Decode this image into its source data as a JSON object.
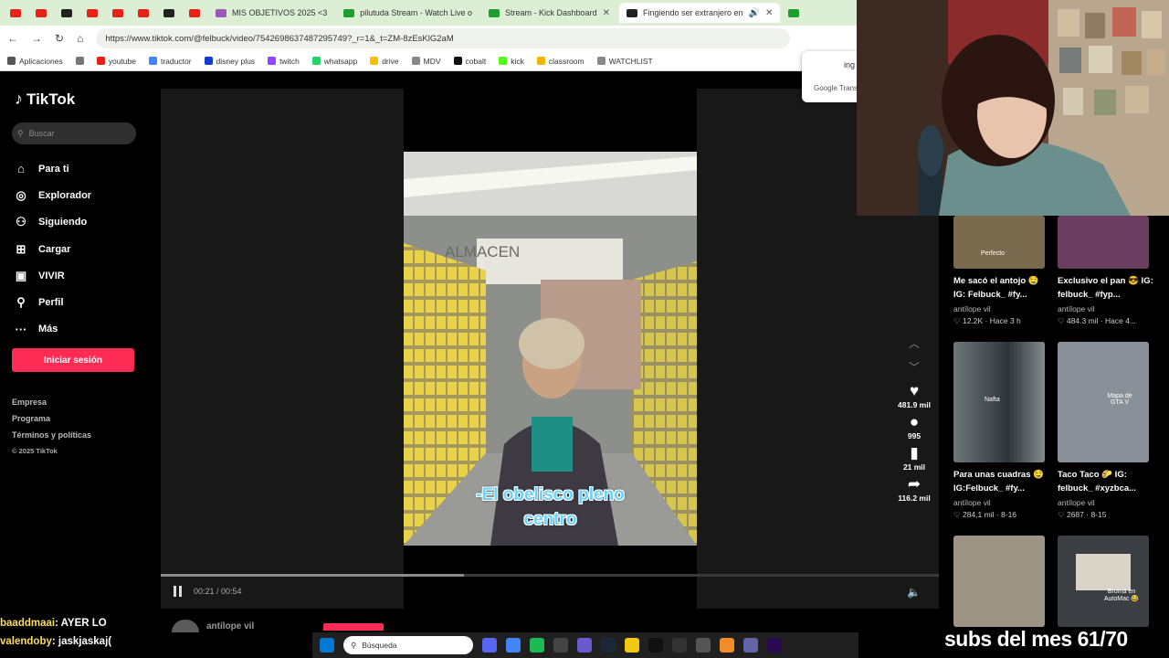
{
  "browser": {
    "tabs": [
      {
        "label": "MIS OBJETIVOS 2025 <3",
        "icon": "purple-icon"
      },
      {
        "label": "pilutuda Stream - Watch Live o",
        "icon": "kick-icon"
      },
      {
        "label": "Stream - Kick Dashboard",
        "icon": "kick-icon"
      },
      {
        "label": "Fingiendo ser extranjero en",
        "icon": "tiktok-icon",
        "active": true
      }
    ],
    "tab_close": "✕",
    "url": "https://www.tiktok.com/@felbuck/video/7542698637487295749?_r=1&_t=ZM-8zEsKlG2aM",
    "bookmarks": [
      "Aplicaciones",
      "youtube",
      "traductor",
      "disney plus",
      "twitch",
      "whatsapp",
      "drive",
      "MDV",
      "cobalt",
      "kick",
      "classroom",
      "WATCHLIST"
    ],
    "translate_popup": {
      "text1": "ing",
      "text2": "Google Trans"
    }
  },
  "tiktok": {
    "logo": "TikTok",
    "search_placeholder": "Buscar",
    "nav": [
      {
        "label": "Para ti",
        "icon": "home-icon"
      },
      {
        "label": "Explorador",
        "icon": "compass-icon"
      },
      {
        "label": "Siguiendo",
        "icon": "following-icon"
      },
      {
        "label": "Cargar",
        "icon": "upload-icon"
      },
      {
        "label": "VIVIR",
        "icon": "live-icon"
      },
      {
        "label": "Perfil",
        "icon": "profile-icon"
      },
      {
        "label": "Más",
        "icon": "more-icon"
      }
    ],
    "login": "Iniciar sesión",
    "footer": [
      "Empresa",
      "Programa",
      "Términos y políticas",
      "© 2025 TikTok"
    ],
    "video": {
      "subtitle_line1": "-El obelisco pleno",
      "subtitle_line2": "centro",
      "time": "00:21 / 00:54",
      "progress": 0.39
    },
    "actions": {
      "likes": "481.9 mil",
      "comments": "995",
      "saves": "21 mil",
      "shares": "116.2 mil"
    },
    "related": [
      {
        "title": "Me sacó el antojo 🤤 IG: Felbuck_ #fy...",
        "author": "antílope vil",
        "stats": "♡ 12.2K · Hace 3 h"
      },
      {
        "title": "Exclusivo el pan 😎 IG: felbuck_ #fyp...",
        "author": "antílope vil",
        "stats": "♡ 484.3 mil · Hace 4..."
      },
      {
        "title": "Para unas cuadras 🤤 IG:Felbuck_ #fy...",
        "author": "antílope vil",
        "stats": "♡ 284,1 mil · 8-16"
      },
      {
        "title": "Taco Taco 🌮 IG: felbuck_ #xyzbca...",
        "author": "antílope vil",
        "stats": "♡ 2687 · 8-15"
      }
    ],
    "thumb_texts": [
      "Perfecto",
      "Nafta",
      "Mapa de GTA V",
      "Broma en AutoMac 😂"
    ],
    "overlay_name": "antílope vil"
  },
  "stream": {
    "chat": [
      {
        "user": "baaddmaai",
        "message": ": AYER LO"
      },
      {
        "user": "valendoby",
        "message": ": jaskjaskaj("
      }
    ],
    "taskbar_search": "Búsqueda",
    "subs": "subs del mes 61/70"
  }
}
